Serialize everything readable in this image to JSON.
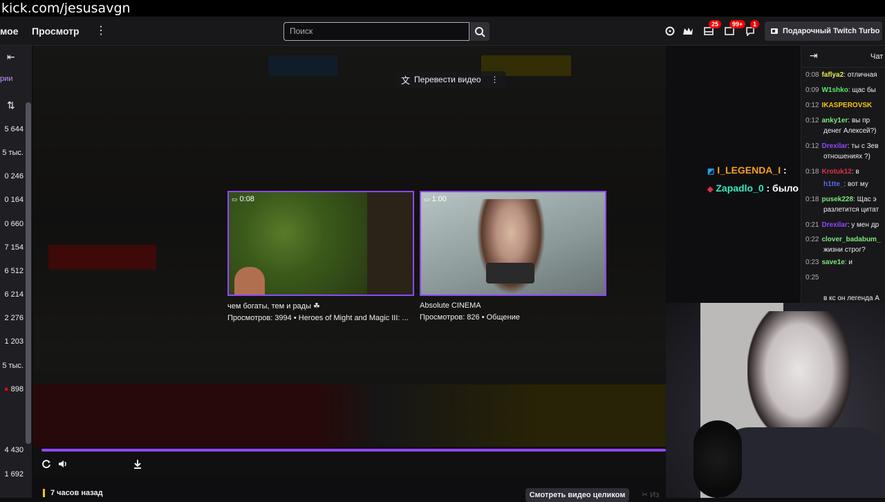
{
  "watermark": "kick.com/jesusavgn",
  "topnav": {
    "link_1": "мое",
    "link_2": "Просмотр",
    "more": "⋮",
    "search_placeholder": "Поиск",
    "badges": {
      "inbox": "25",
      "notifications": "99+",
      "whispers": "1"
    },
    "turbo_label": "Подарочный Twitch Turbo"
  },
  "sidebar": {
    "collapse": "⇤",
    "section_label": "рии",
    "sort": "⇅",
    "counts": [
      "5 644",
      "5 тыс.",
      "0 246",
      "0 164",
      "0 660",
      "7 154",
      "6 512",
      "6 214",
      "2 276",
      "1 203",
      "5 тыс.",
      "898",
      "4 430",
      "1 692"
    ]
  },
  "player": {
    "translate_label": "Перевести видео",
    "recommendations": [
      {
        "duration": "0:08",
        "title": "чем богаты, тем и рады ☘",
        "meta": "Просмотров: 3994 • Heroes of Might and Magic III: ..."
      },
      {
        "duration": "1:00",
        "title": "Absolute CINEMA",
        "meta": "Просмотров: 826 • Общение"
      }
    ],
    "progress": 1.0
  },
  "overlay_chat": [
    {
      "user": "I_LEGENDA_I",
      "text": ":"
    },
    {
      "user": "Zapadlo_0",
      "text": ": было дело"
    }
  ],
  "chat": {
    "title": "Чат",
    "messages": [
      {
        "time": "0:08",
        "user": "faflya2",
        "text": ": отличная",
        "color": "#e8e84a"
      },
      {
        "time": "0:09",
        "user": "W1shko",
        "text": ": щас бы",
        "color": "#5ae86a"
      },
      {
        "time": "0:12",
        "user": "IKASPEROVSK",
        "text": "",
        "color": "#f5c518"
      },
      {
        "time": "0:12",
        "user": "anky1er",
        "text": ": вы пр",
        "color": "#7be87a"
      },
      {
        "time": "",
        "user": "",
        "text": "денег Алексей?)",
        "color": "#efeff1"
      },
      {
        "time": "0:12",
        "user": "Drexilar",
        "text": ": ты с Зев",
        "color": "#9147ff"
      },
      {
        "time": "",
        "user": "",
        "text": "отношениях ?)",
        "color": "#efeff1"
      },
      {
        "time": "0:18",
        "user": "Krotuk12",
        "text": ": в",
        "color": "#e0304a"
      },
      {
        "time": "",
        "user": "h1tte_",
        "text": ": вот му",
        "color": "#5a6ae8"
      },
      {
        "time": "0:18",
        "user": "pusek228",
        "text": ": Щас э",
        "color": "#7be87a"
      },
      {
        "time": "",
        "user": "",
        "text": "разлетится цитат",
        "color": "#efeff1"
      },
      {
        "time": "0:21",
        "user": "Drexilar",
        "text": ": у мен др",
        "color": "#9147ff"
      },
      {
        "time": "0:22",
        "user": "clover_badabum_",
        "text": "",
        "color": "#7be87a"
      },
      {
        "time": "",
        "user": "",
        "text": "жизни строг?",
        "color": "#efeff1"
      },
      {
        "time": "0:23",
        "user": "save1e",
        "text": ": и",
        "color": "#7be87a"
      },
      {
        "time": "0:25",
        "user": "",
        "text": "",
        "color": "#efeff1"
      },
      {
        "time": "",
        "user": "",
        "text": "в кс он легенда А",
        "color": "#efeff1"
      }
    ]
  },
  "bottom": {
    "time_ago": "7 часов назад",
    "watch_full": "Смотреть видео целиком",
    "clip": "Из"
  },
  "colors": {
    "accent": "#9147ff",
    "bg": "#0e0e10",
    "panel": "#18181b"
  }
}
